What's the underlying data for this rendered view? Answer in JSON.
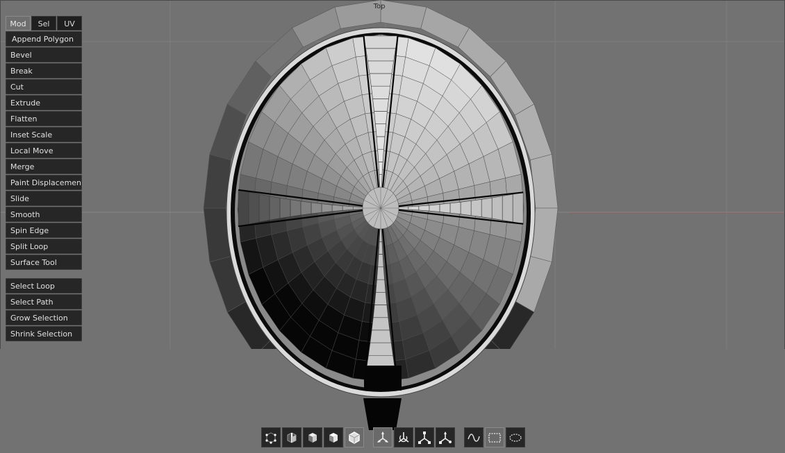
{
  "viewport": {
    "view_label": "Top"
  },
  "panel": {
    "tabs": [
      {
        "label": "Mod",
        "active": true
      },
      {
        "label": "Sel",
        "active": false
      },
      {
        "label": "UV",
        "active": false
      }
    ],
    "modeling_tools": [
      "Append Polygon",
      "Bevel",
      "Break",
      "Cut",
      "Extrude",
      "Flatten",
      "Inset Scale",
      "Local Move",
      "Merge",
      "Paint Displacement",
      "Slide",
      "Smooth",
      "Spin Edge",
      "Split Loop",
      "Surface Tool"
    ],
    "selection_tools": [
      "Select Loop",
      "Select Path",
      "Grow Selection",
      "Shrink Selection"
    ]
  },
  "toolbar": {
    "display_modes": [
      {
        "icon": "vertex-mode-icon",
        "active": false
      },
      {
        "icon": "edge-mode-icon",
        "active": false
      },
      {
        "icon": "face-mode-icon",
        "active": false
      },
      {
        "icon": "object-mode-icon",
        "active": false
      },
      {
        "icon": "wireframe-cube-icon",
        "active": true
      }
    ],
    "transform_tools": [
      {
        "icon": "move-axis-icon",
        "active": true
      },
      {
        "icon": "rotate-axis-icon",
        "active": false
      },
      {
        "icon": "scale-axis-icon",
        "active": false
      },
      {
        "icon": "universal-axis-icon",
        "active": false
      }
    ],
    "select_tools": [
      {
        "icon": "lasso-curve-icon",
        "active": false
      },
      {
        "icon": "rect-select-icon",
        "active": true
      },
      {
        "icon": "ellipse-select-icon",
        "active": false
      }
    ]
  }
}
